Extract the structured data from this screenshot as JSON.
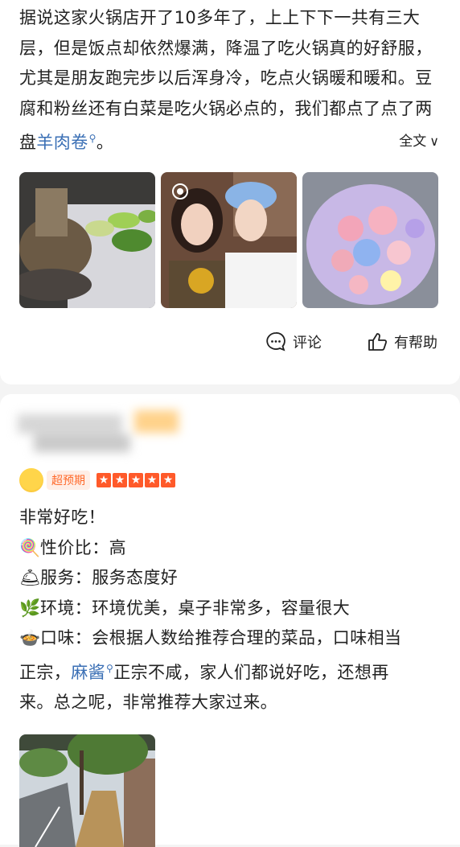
{
  "review1": {
    "text_before_kw": "据说这家火锅店开了10多年了，上上下下一共有三大层，但是饭点却依然爆满，降温了吃火锅真的好舒服，尤其是朋友跑完步以后浑身冷，吃点火锅暖和暖和。豆腐和粉丝还有白菜是吃火锅必点的，我们都点了点了两盘",
    "keyword": "羊肉卷",
    "text_after_kw": "。",
    "expand_label": "全文",
    "photos": [
      "hotpot-photo",
      "selfie-photo",
      "bouquet-photo"
    ],
    "actions": {
      "comment_label": "评论",
      "helpful_label": "有帮助"
    }
  },
  "review2": {
    "badge_label": "超预期",
    "star_count": 5,
    "title_line": "非常好吃！",
    "rows": [
      {
        "icon": "🍭",
        "label": "性价比：",
        "value": "高"
      },
      {
        "icon": "🛎",
        "label": "服务：",
        "value": "服务态度好"
      },
      {
        "icon": "🌿",
        "label": "环境：",
        "value": "环境优美，桌子非常多，容量很大"
      }
    ],
    "taste": {
      "icon": "🍲",
      "label": "口味：",
      "text1": "会根据人数给推荐合理的菜品，口味相当",
      "text2_before": "正宗，",
      "keyword": "麻酱",
      "text2_after": "正宗不咸，家人们都说好吃，还想再",
      "text3": "来。总之呢，非常推荐大家过来。"
    }
  },
  "colors": {
    "accent_orange": "#ff5a2a",
    "link_blue": "#3a6fb5"
  }
}
